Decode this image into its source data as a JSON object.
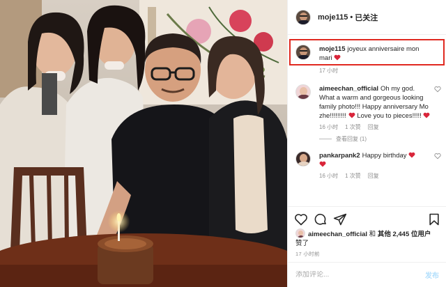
{
  "post": {
    "username": "moje115",
    "separator": "•",
    "follow_status": "已关注"
  },
  "caption": {
    "username": "moje115",
    "text": "joyeux anniversaire mon mari",
    "time": "17 小时"
  },
  "comments": [
    {
      "username": "aimeechan_official",
      "text": "Oh my god. What a warm and gorgeous looking family photo!!! Happy anniversary Mo zhe!!!!!!!!!",
      "text_after": "Love you to pieces!!!!!",
      "time": "16 小时",
      "likes": "1 次赞",
      "reply": "回复",
      "view_replies": "查看回复 (1)"
    },
    {
      "username": "pankarpank2",
      "text": "Happy birthday",
      "time": "16 小时",
      "likes": "1 次赞",
      "reply": "回复"
    }
  ],
  "likes": {
    "username": "aimeechan_official",
    "connector": "和",
    "others": "其他 2,445 位用户",
    "suffix": "赞了"
  },
  "date": "17 小时前",
  "comment_box": {
    "placeholder": "添加评论...",
    "post_label": "发布"
  },
  "icons": [
    "heart-icon",
    "comment-icon",
    "share-icon",
    "bookmark-icon",
    "heart-emoji-icon"
  ],
  "colors": {
    "highlight": "#e0281f",
    "heart_emoji": "#d9253a",
    "secondary_text": "#8e8e8e",
    "post_button": "#b2dffc"
  }
}
